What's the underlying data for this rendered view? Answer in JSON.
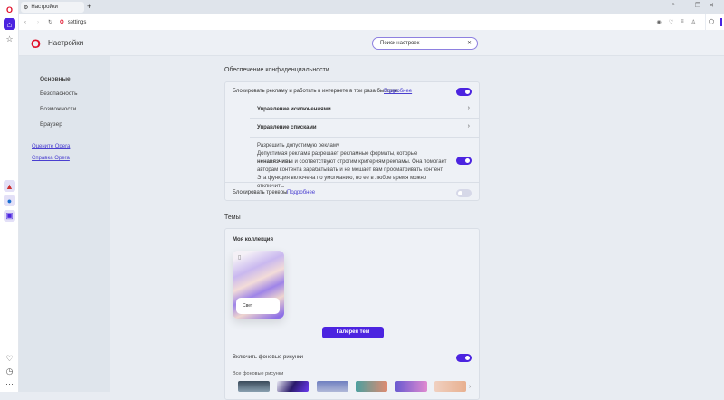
{
  "browser": {
    "tab_title": "Настройки",
    "address": "settings"
  },
  "header": {
    "title": "Настройки",
    "search_value": "Поиск настроек"
  },
  "nav": {
    "items": [
      "Основные",
      "Безопасность",
      "Возможности",
      "Браузер"
    ],
    "links": [
      "Оцените Opera",
      "Справка Opera"
    ]
  },
  "privacy": {
    "title": "Обеспечение конфиденциальности",
    "block_ads": {
      "label": "Блокировать рекламу и работать в интернете в три раза быстрее",
      "link": "Подробнее",
      "enabled": true
    },
    "manage_exceptions": "Управление исключениями",
    "manage_lists": "Управление списками",
    "acceptable_ads": {
      "title": "Разрешить допустимую рекламу",
      "desc_before": "Допустимая реклама разрешает рекламные форматы, которые ",
      "desc_bold": "ненавязчивы",
      "desc_after": " и соответствуют строгим критериям рекламы. Она помогает авторам контента зарабатывать и не мешает вам просматривать контент. Эта функция включена по умолчанию, но ее в любое время можно отключить.",
      "enabled": true
    },
    "block_trackers": {
      "label": "Блокировать трекеры",
      "link": "Подробнее",
      "enabled": false
    }
  },
  "themes": {
    "title": "Темы",
    "collection_title": "Моя коллекция",
    "theme_name": "Свет",
    "gallery_button": "Галерея тем",
    "bg_images_label": "Включить фоновые рисунки",
    "bg_images_enabled": true,
    "all_bg_label": "Все фоновые рисунки"
  },
  "colors": {
    "accent": "#4c24e0",
    "opera_red": "#e0102a"
  }
}
